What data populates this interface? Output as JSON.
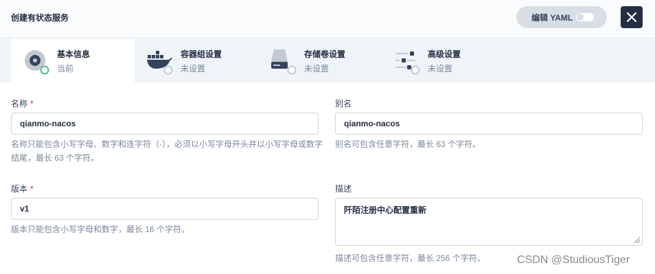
{
  "header": {
    "title": "创建有状态服务",
    "yaml_label": "编辑 YAML",
    "yaml_toggle_on": false
  },
  "steps": [
    {
      "title": "基本信息",
      "subtitle": "当前",
      "icon": "info-disc-icon",
      "status": "current"
    },
    {
      "title": "容器组设置",
      "subtitle": "未设置",
      "icon": "docker-whale-icon",
      "status": "unset"
    },
    {
      "title": "存储卷设置",
      "subtitle": "未设置",
      "icon": "storage-volume-icon",
      "status": "unset"
    },
    {
      "title": "高级设置",
      "subtitle": "未设置",
      "icon": "sliders-icon",
      "status": "unset"
    }
  ],
  "form": {
    "name": {
      "label": "名称",
      "required_mark": "*",
      "value": "qianmo-nacos",
      "help": "名称只能包含小写字母、数字和连字符（-），必须以小写字母开头并以小写字母或数字结尾，最长 63 个字符。"
    },
    "alias": {
      "label": "别名",
      "value": "qianmo-nacos",
      "help": "别名可包含任意字符，最长 63 个字符。"
    },
    "version": {
      "label": "版本",
      "required_mark": "*",
      "value": "v1",
      "help": "版本只能包含小写字母和数字，最长 16 个字符。"
    },
    "description": {
      "label": "描述",
      "value": "阡陌注册中心配置重新",
      "help": "描述可包含任意字符，最长 256 个字符。"
    }
  },
  "watermark": "CSDN @StudiousTiger",
  "colors": {
    "dark": "#242e42",
    "muted": "#79879c",
    "required": "#ca2621",
    "current_ring": "#55bc8a",
    "step_bar": "#eff4f9"
  }
}
